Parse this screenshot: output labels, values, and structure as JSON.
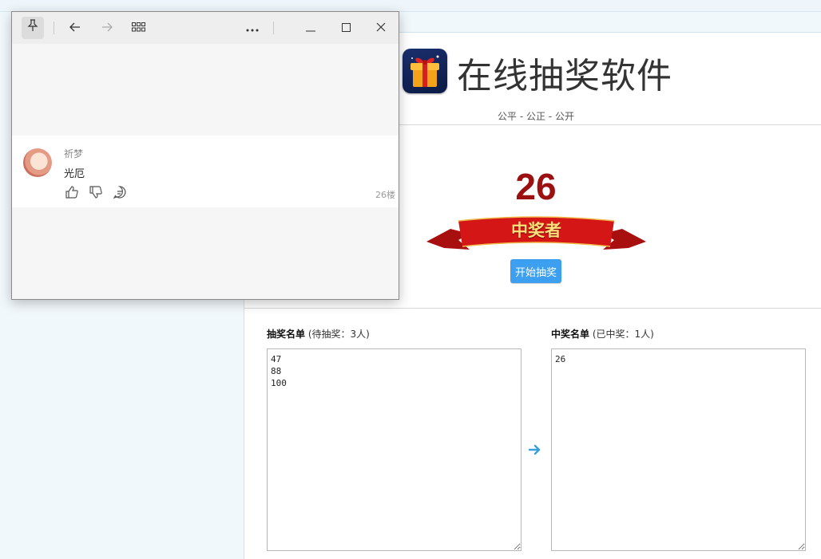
{
  "app": {
    "title": "在线抽奖软件",
    "slogan": "公平 - 公正 - 公开"
  },
  "winner": {
    "current_number": "26",
    "banner_label": "中奖者",
    "start_button_label": "开始抽奖"
  },
  "lists": {
    "pending": {
      "title": "抽奖名单",
      "count_text": "(待抽奖：3人)",
      "content": "47\n88\n100"
    },
    "winners": {
      "title": "中奖名单",
      "count_text": "(已中奖：1人)",
      "content": "26"
    },
    "arrow_icon": "right-arrow-icon"
  },
  "popup": {
    "toolbar_icons": [
      "pin-icon",
      "back-arrow-icon",
      "forward-arrow-icon",
      "apps-grid-icon",
      "more-icon",
      "minimize-icon",
      "maximize-icon",
      "close-icon"
    ],
    "comment": {
      "user_name": "祈梦",
      "text": "光厄",
      "floor": "26楼",
      "action_icons": [
        "thumbs-up-icon",
        "thumbs-down-icon",
        "reply-icon"
      ]
    }
  },
  "colors": {
    "accent_button": "#3c9ff0",
    "winner_number": "#9b1010",
    "banner_red": "#c81414",
    "page_background": "#f1f8fc"
  }
}
